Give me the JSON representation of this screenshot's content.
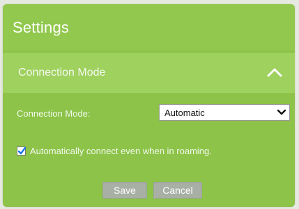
{
  "header": {
    "title": "Settings"
  },
  "section": {
    "title": "Connection Mode",
    "collapse_icon": "chevron-up-icon"
  },
  "form": {
    "connection_mode_label": "Connection Mode:",
    "connection_mode_value": "Automatic",
    "roaming_checkbox_checked": true,
    "roaming_label": "Automatically connect even when in roaming."
  },
  "buttons": {
    "save_label": "Save",
    "cancel_label": "Cancel"
  },
  "colors": {
    "panel": "#8dc449",
    "section_header": "#9fd15f",
    "button": "#a8b0a6",
    "checkbox_check": "#1a73e8"
  }
}
